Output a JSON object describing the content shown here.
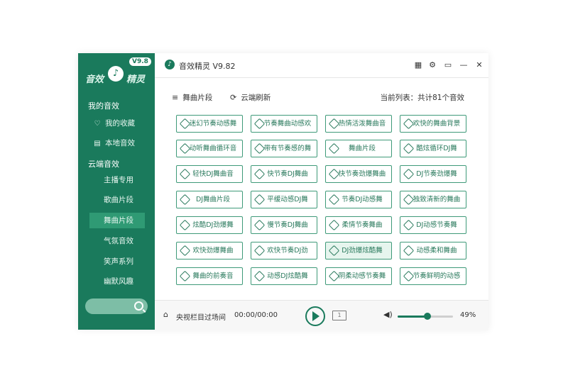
{
  "colors": {
    "brand": "#1a7a5c",
    "accent": "#2f9a74",
    "button_border": "#3f9a79"
  },
  "logo": {
    "left_text": "音效",
    "right_text": "精灵",
    "version_badge": "V9.8"
  },
  "sidebar": {
    "section_my": "我的音效",
    "my_items": [
      {
        "label": "我的收藏",
        "icon": "heart-icon"
      },
      {
        "label": "本地音效",
        "icon": "folder-icon"
      }
    ],
    "section_cloud": "云端音效",
    "cloud_items": [
      {
        "label": "主播专用"
      },
      {
        "label": "歌曲片段"
      },
      {
        "label": "舞曲片段",
        "active": true
      },
      {
        "label": "气氛音效"
      },
      {
        "label": "笑声系列"
      },
      {
        "label": "幽默风趣"
      }
    ]
  },
  "titlebar": {
    "title": "音效精灵 V9.82"
  },
  "tabs": [
    {
      "label": "舞曲片段",
      "icon": "list-icon"
    },
    {
      "label": "云端刷新",
      "icon": "refresh-icon"
    }
  ],
  "playlist_info": "当前列表：共计81个音效",
  "sound_buttons": [
    [
      "迷幻节奏动感舞",
      "节奏舞曲动感欢",
      "热情活泼舞曲音",
      "欢快的舞曲背景"
    ],
    [
      "动听舞曲循环音",
      "带有节奏感的舞",
      "舞曲片段",
      "酷炫循环DJ舞"
    ],
    [
      "轻快DJ舞曲音",
      "快节奏DJ舞曲",
      "快节奏劲爆舞曲",
      "DJ节奏劲爆舞"
    ],
    [
      "DJ舞曲片段",
      "平缓动感DJ舞",
      "节奏DJ动感舞",
      "独致清新的舞曲"
    ],
    [
      "炫酷DJ劲爆舞",
      "慢节奏DJ舞曲",
      "柔情节奏舞曲",
      "DJ动感节奏舞"
    ],
    [
      "欢快劲爆舞曲",
      "欢快节奏DJ劲",
      "DJ劲爆炫酷舞",
      "动感柔和舞曲"
    ],
    [
      "舞曲的前奏音",
      "动感DJ炫酷舞",
      "阴柔动感节奏舞",
      "节奏鲜明的动感"
    ]
  ],
  "selected_button": "DJ劲爆炫酷舞",
  "player": {
    "now_playing": "央视栏目过场间",
    "time": "00:00/00:00",
    "volume_percent": 49,
    "volume_label": "49%"
  }
}
